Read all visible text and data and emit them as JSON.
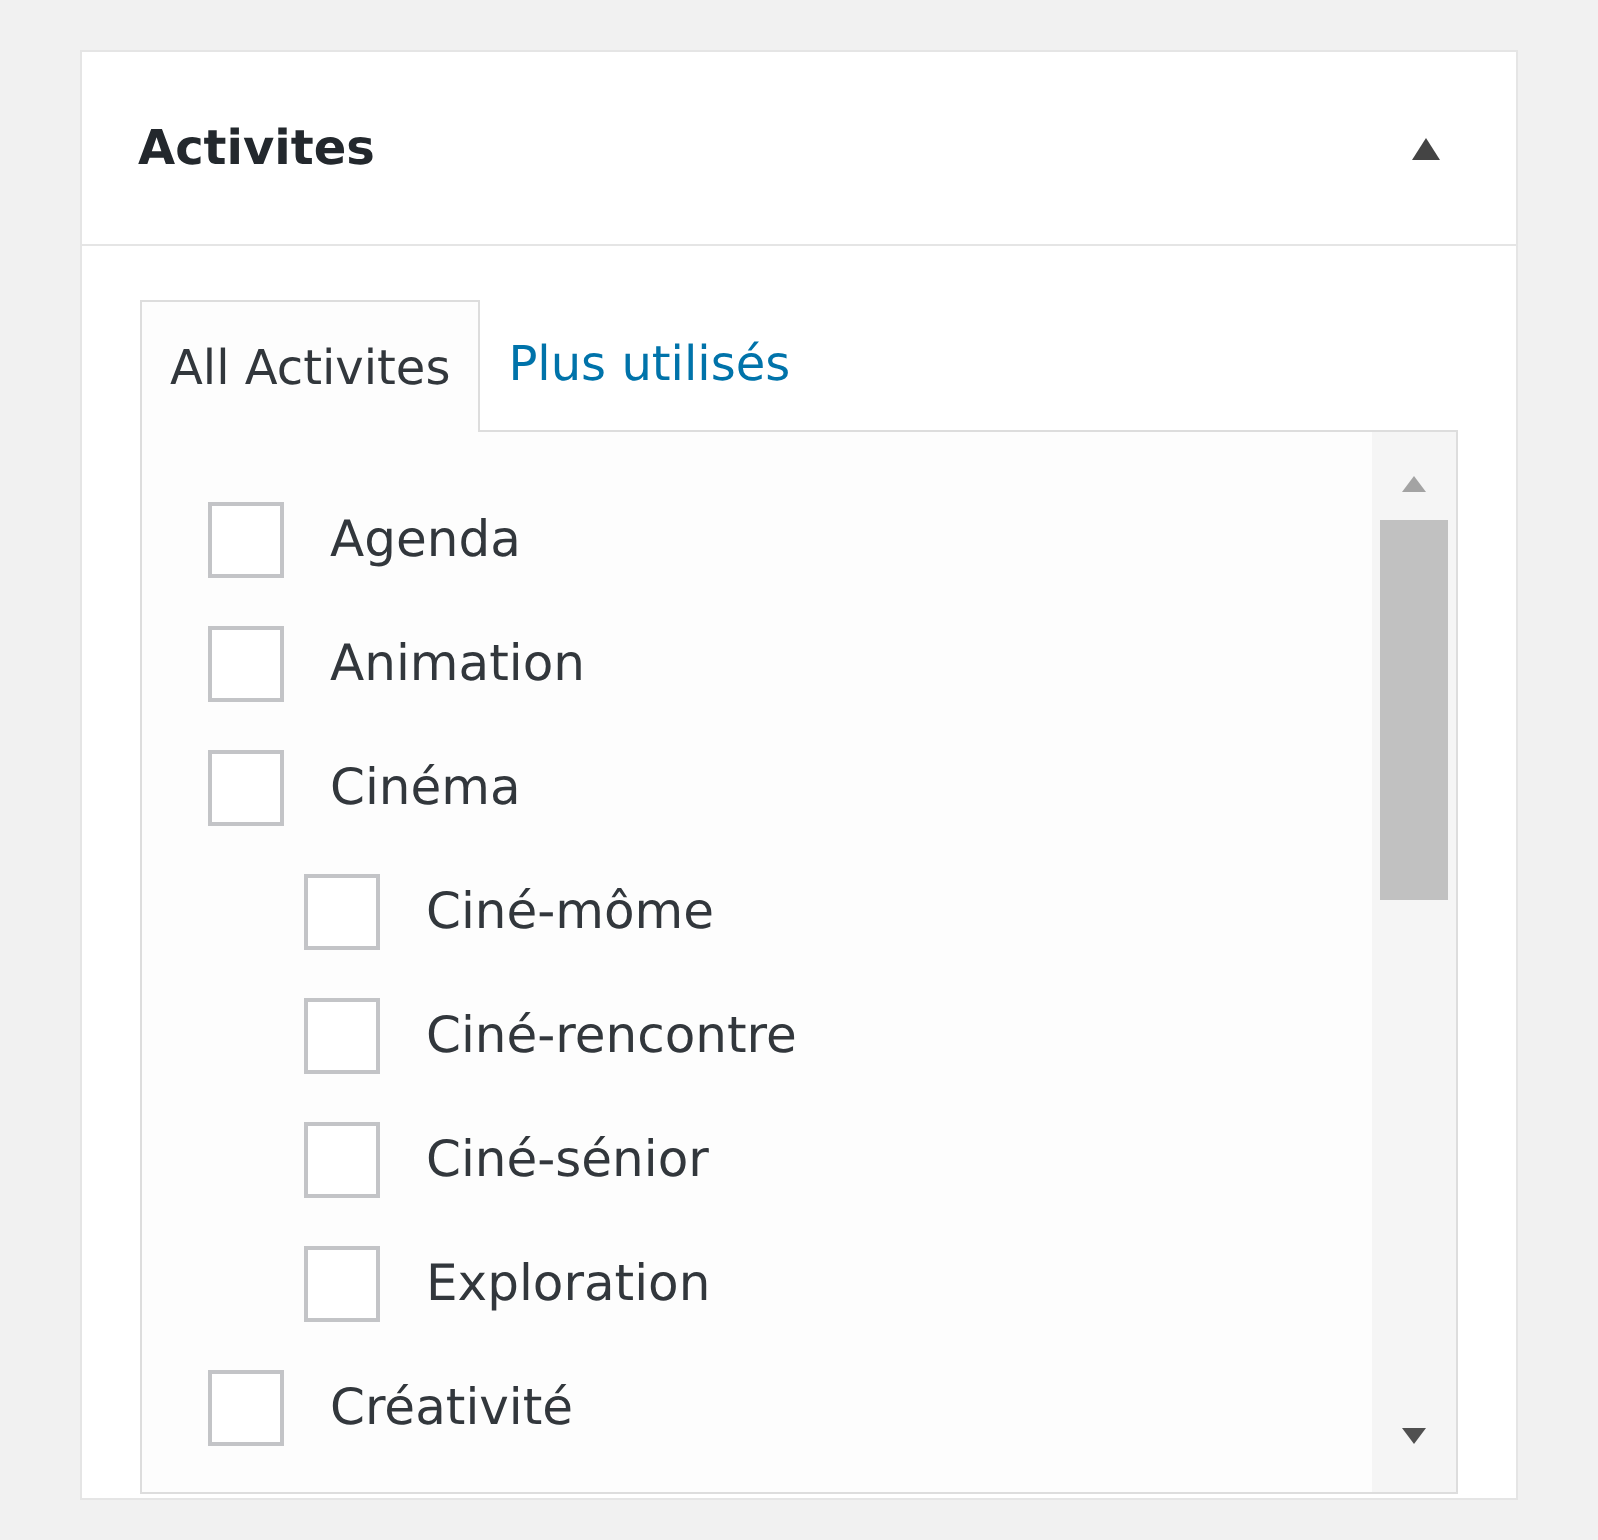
{
  "panel": {
    "title": "Activites",
    "expanded": true
  },
  "tabs": [
    {
      "label": "All Activites",
      "selected": true
    },
    {
      "label": "Plus utilisés",
      "selected": false
    }
  ],
  "items": [
    {
      "label": "Agenda",
      "checked": false
    },
    {
      "label": "Animation",
      "checked": false
    },
    {
      "label": "Cinéma",
      "checked": false,
      "children": [
        {
          "label": "Ciné-môme",
          "checked": false
        },
        {
          "label": "Ciné-rencontre",
          "checked": false
        },
        {
          "label": "Ciné-sénior",
          "checked": false
        },
        {
          "label": "Exploration",
          "checked": false
        }
      ]
    },
    {
      "label": "Créativité",
      "checked": false
    }
  ]
}
